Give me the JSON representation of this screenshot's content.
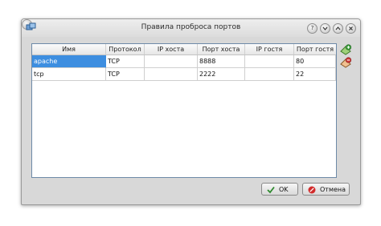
{
  "window": {
    "title": "Правила проброса портов"
  },
  "table": {
    "headers": [
      "Имя",
      "Протокол",
      "IP хоста",
      "Порт хоста",
      "IP гостя",
      "Порт гостя"
    ],
    "rows": [
      {
        "name": "apache",
        "protocol": "TCP",
        "host_ip": "",
        "host_port": "8888",
        "guest_ip": "",
        "guest_port": "80"
      },
      {
        "name": "tcp",
        "protocol": "TCP",
        "host_ip": "",
        "host_port": "2222",
        "guest_ip": "",
        "guest_port": "22"
      }
    ]
  },
  "buttons": {
    "ok": "OK",
    "cancel": "Отмена"
  },
  "colors": {
    "selection": "#3d8ee0",
    "ok_check": "#2e8a2e",
    "cancel_icon": "#d22b2b"
  },
  "icons": [
    "app-icon",
    "pin-icon",
    "help-icon",
    "minimize-icon",
    "maximize-icon",
    "close-icon",
    "add-rule-icon",
    "remove-rule-icon",
    "check-icon",
    "cancel-icon"
  ]
}
